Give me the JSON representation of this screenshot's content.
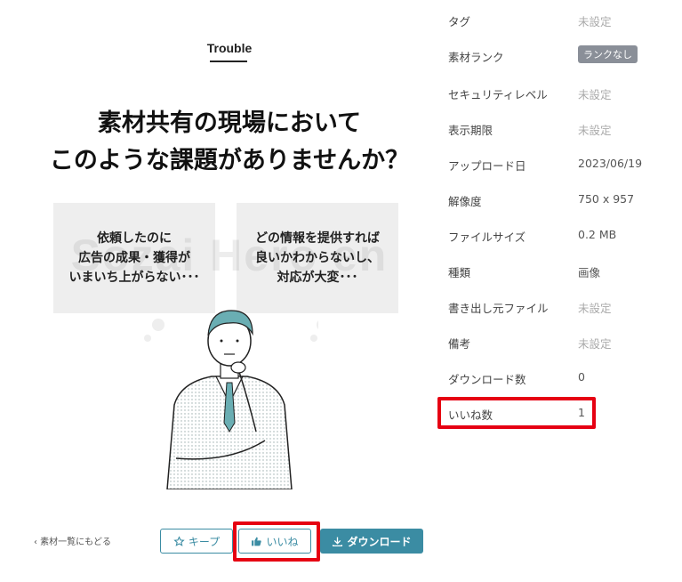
{
  "preview": {
    "trouble_label": "Trouble",
    "headline": "素材共有の現場において\nこのような課題がありませんか？",
    "bubble_left": "依頼したのに\n広告の成果・獲得が\nいまいち上がらない･･･",
    "bubble_right": "どの情報を提供すれば\n良いかわからないし、\n対応が大変･･･",
    "watermark": "Sozai Hero en"
  },
  "footer": {
    "back_link": "‹ 素材一覧にもどる",
    "keep_label": "キープ",
    "like_label": "いいね",
    "download_label": "ダウンロード"
  },
  "metadata": {
    "rows": [
      {
        "label": "タグ",
        "value": "未設定",
        "unset": true
      },
      {
        "label": "素材ランク",
        "value": "ランクなし",
        "badge": true
      },
      {
        "label": "セキュリティレベル",
        "value": "未設定",
        "unset": true
      },
      {
        "label": "表示期限",
        "value": "未設定",
        "unset": true
      },
      {
        "label": "アップロード日",
        "value": "2023/06/19"
      },
      {
        "label": "解像度",
        "value": "750 x 957"
      },
      {
        "label": "ファイルサイズ",
        "value": "0.2 MB"
      },
      {
        "label": "種類",
        "value": "画像"
      },
      {
        "label": "書き出し元ファイル",
        "value": "未設定",
        "unset": true
      },
      {
        "label": "備考",
        "value": "未設定",
        "unset": true
      },
      {
        "label": "ダウンロード数",
        "value": "0"
      },
      {
        "label": "いいね数",
        "value": "1"
      }
    ]
  },
  "colors": {
    "accent": "#3b8ca3",
    "highlight": "#e60012",
    "badge": "#8a8f98"
  }
}
